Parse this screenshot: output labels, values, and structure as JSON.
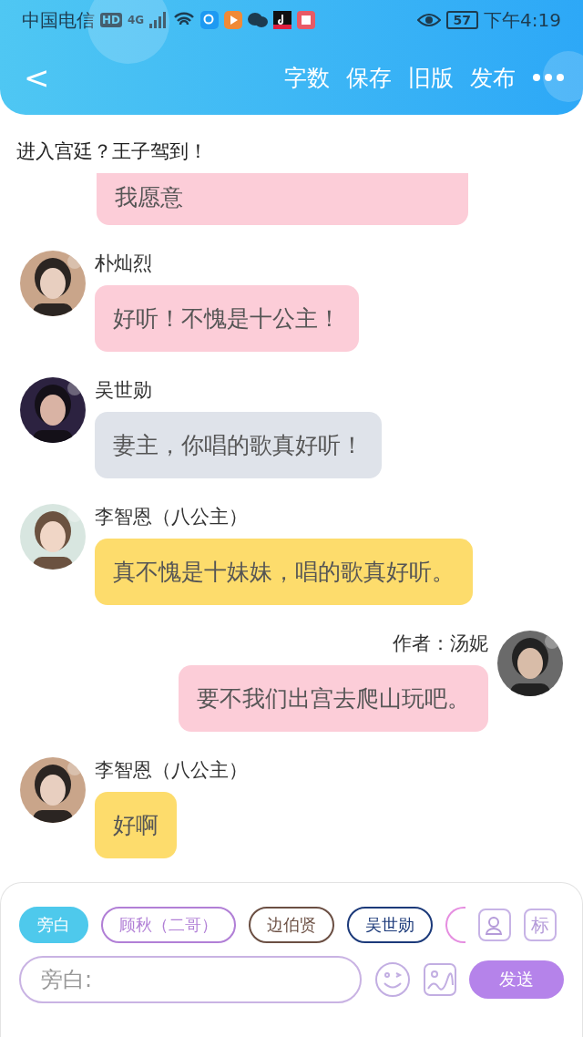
{
  "status_bar": {
    "carrier": "中国电信",
    "hd": "HD",
    "network": "4G",
    "battery": "57",
    "time": "下午4:19"
  },
  "header": {
    "back": "<",
    "actions": [
      "字数",
      "保存",
      "旧版",
      "发布"
    ]
  },
  "narration": "进入宫廷？王子驾到！",
  "messages": [
    {
      "kind": "cut",
      "text": "我愿意",
      "color": "#fccdd8"
    },
    {
      "kind": "incoming",
      "name": "朴灿烈",
      "text": "好听！不愧是十公主！",
      "color": "#fccdd8"
    },
    {
      "kind": "incoming",
      "name": "吴世勋",
      "text": "妻主，你唱的歌真好听！",
      "color": "#dfe3ea"
    },
    {
      "kind": "incoming",
      "name": "李智恩（八公主）",
      "text": "真不愧是十妹妹，唱的歌真好听。",
      "color": "#fddc6c"
    },
    {
      "kind": "outgoing",
      "name": "作者：汤妮",
      "text": "要不我们出宫去爬山玩吧。",
      "color": "#fccdd8"
    },
    {
      "kind": "incoming",
      "name": "李智恩（八公主）",
      "text": "好啊",
      "color": "#fddc6c"
    }
  ],
  "composer": {
    "roles": [
      {
        "kind": "chip",
        "label": "旁白",
        "selected": true,
        "color": "#4ec9ec"
      },
      {
        "kind": "chip",
        "label": "顾秋（二哥）",
        "selected": false,
        "color": "#b17fd6"
      },
      {
        "kind": "chip",
        "label": "边伯贤",
        "selected": false,
        "color": "#6b4f43"
      },
      {
        "kind": "chip",
        "label": "吴世勋",
        "selected": false,
        "color": "#1c3a7a"
      },
      {
        "kind": "cut",
        "selected": false,
        "color": "#e58ee0"
      }
    ],
    "tag_button": "标",
    "placeholder": "旁白:",
    "send": "发送"
  }
}
